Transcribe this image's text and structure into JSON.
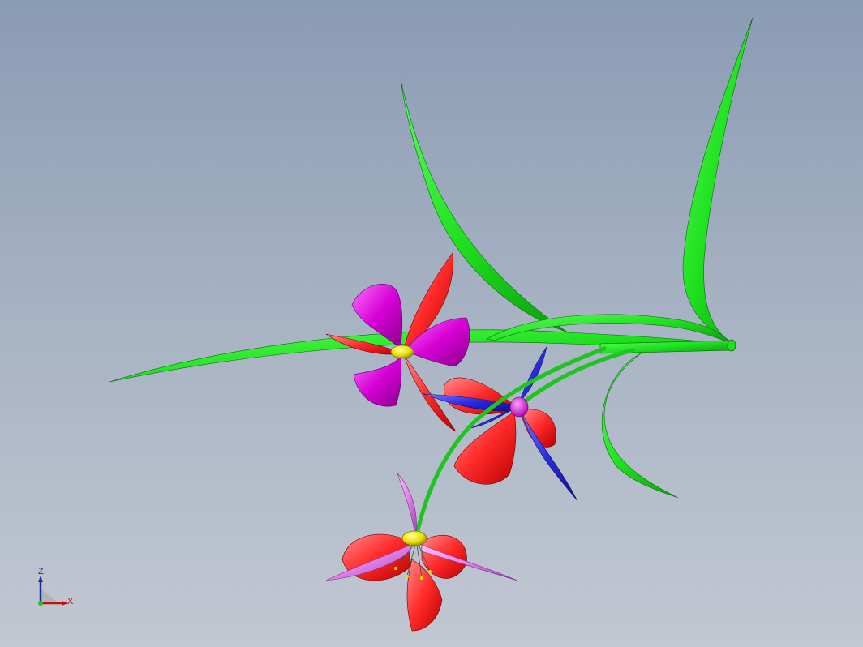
{
  "view": {
    "background_top": "#8a9bb4",
    "background_bottom": "#c2c8d2"
  },
  "model": {
    "icon": "flower-assembly-model",
    "colors": {
      "stem_leaf": "#1fe01f",
      "petal_red": "#ff2a2a",
      "petal_magenta": "#d600d6",
      "petal_blue": "#2a2ae0",
      "petal_pink": "#e080e8",
      "center_yellow": "#e8e000"
    }
  },
  "triad": {
    "axis_z_label": "Z",
    "axis_x_label": "X",
    "axis_z_color": "#1a2ea8",
    "axis_x_color": "#c01010"
  }
}
